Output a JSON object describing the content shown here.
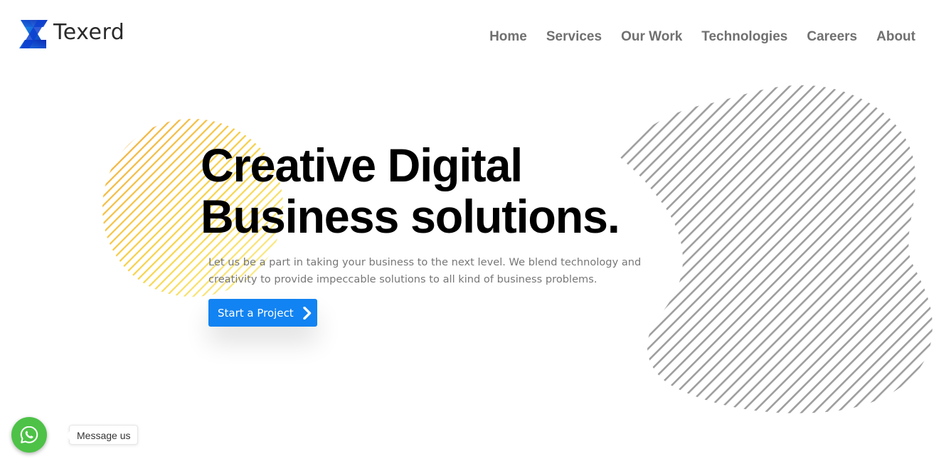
{
  "brand": {
    "name": "Texerd",
    "logo_icon": "x-logo-icon",
    "colors": {
      "logo_dark": "#0a2bb8",
      "logo_light": "#1e9bf0",
      "primary": "#1283f2",
      "nav_text": "#707070",
      "whatsapp": "#4dc247",
      "deco_yellow": "#f5c842",
      "deco_gray": "#9e9e9e"
    }
  },
  "nav": {
    "items": [
      {
        "label": "Home"
      },
      {
        "label": "Services"
      },
      {
        "label": "Our Work"
      },
      {
        "label": "Technologies"
      },
      {
        "label": "Careers"
      },
      {
        "label": "About"
      }
    ]
  },
  "hero": {
    "title_line1": "Creative Digital",
    "title_line2": "Business solutions.",
    "subtitle": "Let us be a part in taking your business to the next level. We blend technology and creativity to provide impeccable solutions to all kind of business problems.",
    "cta_label": "Start a Project",
    "cta_icon": "chevron-right-icon"
  },
  "whatsapp": {
    "icon": "whatsapp-icon",
    "bubble_text": "Message us"
  }
}
